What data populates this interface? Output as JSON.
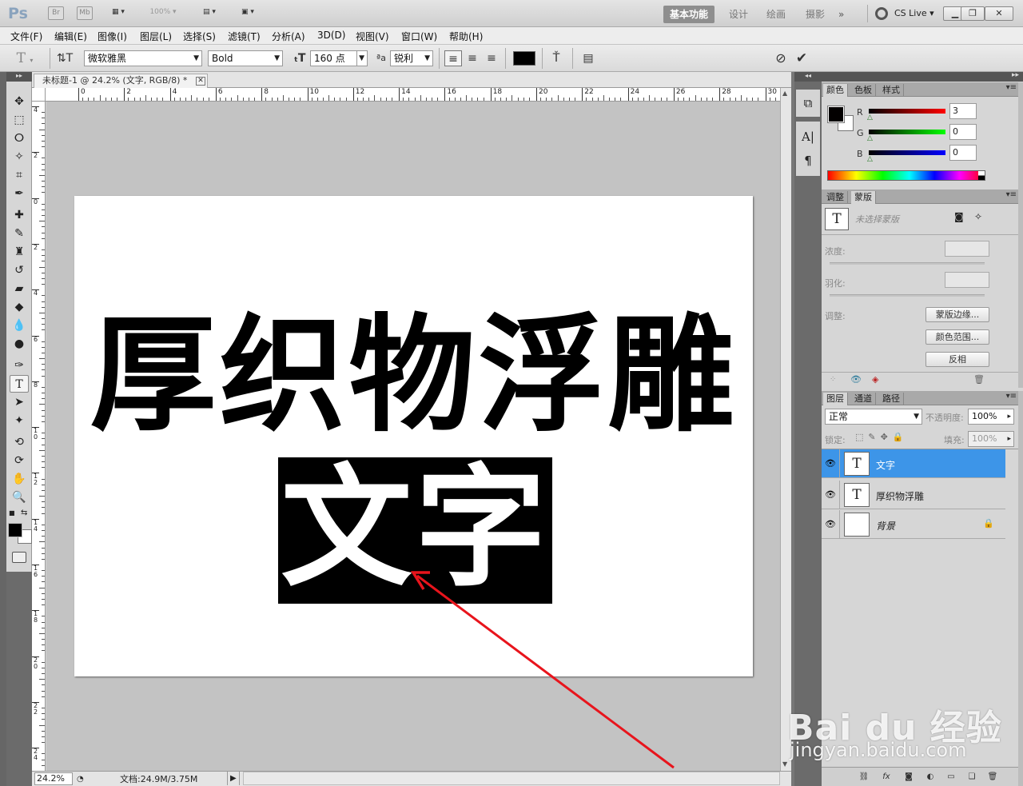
{
  "app": {
    "logo": "Ps",
    "bridge": "Br",
    "mini_bridge": "Mb",
    "zoom": "100%"
  },
  "workspaces": [
    {
      "label": "基本功能",
      "active": true
    },
    {
      "label": "设计",
      "active": false
    },
    {
      "label": "绘画",
      "active": false
    },
    {
      "label": "摄影",
      "active": false
    }
  ],
  "workspace_more": "»",
  "cslive": "CS Live",
  "menus": [
    "文件(F)",
    "编辑(E)",
    "图像(I)",
    "图层(L)",
    "选择(S)",
    "滤镜(T)",
    "分析(A)",
    "3D(D)",
    "视图(V)",
    "窗口(W)",
    "帮助(H)"
  ],
  "options": {
    "font_family": "微软雅黑",
    "font_style": "Bold",
    "font_size": "160 点",
    "antialias_label": "ªa",
    "antialias": "锐利",
    "text_color": "#000000"
  },
  "document": {
    "tab_title": "未标题-1 @ 24.2% (文字, RGB/8) *",
    "ruler_h": [
      "0",
      "2",
      "4",
      "6",
      "8",
      "10",
      "12",
      "14",
      "16",
      "18",
      "20",
      "22",
      "24",
      "26",
      "28",
      "30"
    ],
    "ruler_v": [
      "4",
      "2",
      "0",
      "2",
      "4",
      "6",
      "8",
      "10",
      "12",
      "14",
      "16",
      "18",
      "20",
      "22",
      "24"
    ],
    "headline": "厚织物浮雕",
    "selected_text": "文字"
  },
  "status": {
    "zoom": "24.2%",
    "doc_info": "文档:24.9M/3.75M"
  },
  "color_panel": {
    "tabs": [
      "颜色",
      "色板",
      "样式"
    ],
    "channels": [
      {
        "label": "R",
        "value": "3"
      },
      {
        "label": "G",
        "value": "0"
      },
      {
        "label": "B",
        "value": "0"
      }
    ],
    "foreground": "#030000",
    "background": "#ffffff"
  },
  "masks_panel": {
    "tabs": [
      "调整",
      "蒙版"
    ],
    "status": "未选择蒙版",
    "density_label": "浓度:",
    "feather_label": "羽化:",
    "refine_label": "调整:",
    "buttons": [
      "蒙版边缘...",
      "颜色范围...",
      "反相"
    ]
  },
  "layers_panel": {
    "tabs": [
      "图层",
      "通道",
      "路径"
    ],
    "blend_mode": "正常",
    "opacity_label": "不透明度:",
    "opacity": "100%",
    "lock_label": "锁定:",
    "fill_label": "填充:",
    "fill": "100%",
    "layers": [
      {
        "name": "文字",
        "type": "text",
        "selected": true
      },
      {
        "name": "厚织物浮雕",
        "type": "text",
        "selected": false
      },
      {
        "name": "背景",
        "type": "background",
        "selected": false
      }
    ]
  },
  "watermark": {
    "brand": "Bai du 经验",
    "url": "jingyan.baidu.com"
  },
  "annotation_color": "#e8141c"
}
